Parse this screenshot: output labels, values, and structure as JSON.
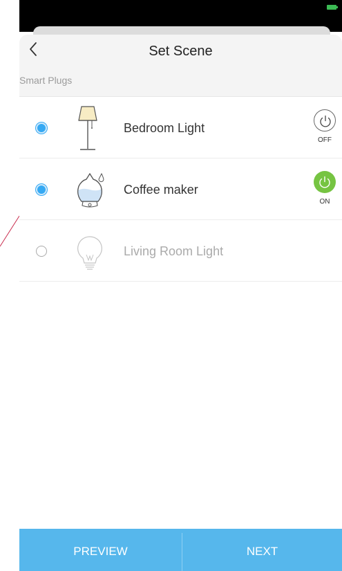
{
  "header": {
    "title": "Set Scene",
    "back_icon": "chevron-left-icon"
  },
  "section": {
    "label": "Smart Plugs"
  },
  "devices": [
    {
      "name": "Bedroom Light",
      "selected": true,
      "icon": "floor-lamp-icon",
      "power_label": "OFF",
      "power_state": "off"
    },
    {
      "name": "Coffee maker",
      "selected": true,
      "icon": "humidifier-icon",
      "power_label": "ON",
      "power_state": "on"
    },
    {
      "name": "Living Room Light",
      "selected": false,
      "icon": "light-bulb-icon"
    }
  ],
  "footer": {
    "preview_label": "PREVIEW",
    "next_label": "NEXT"
  },
  "colors": {
    "accent": "#36a9f3",
    "footer_bg": "#56b7ec",
    "power_on": "#76c442"
  }
}
